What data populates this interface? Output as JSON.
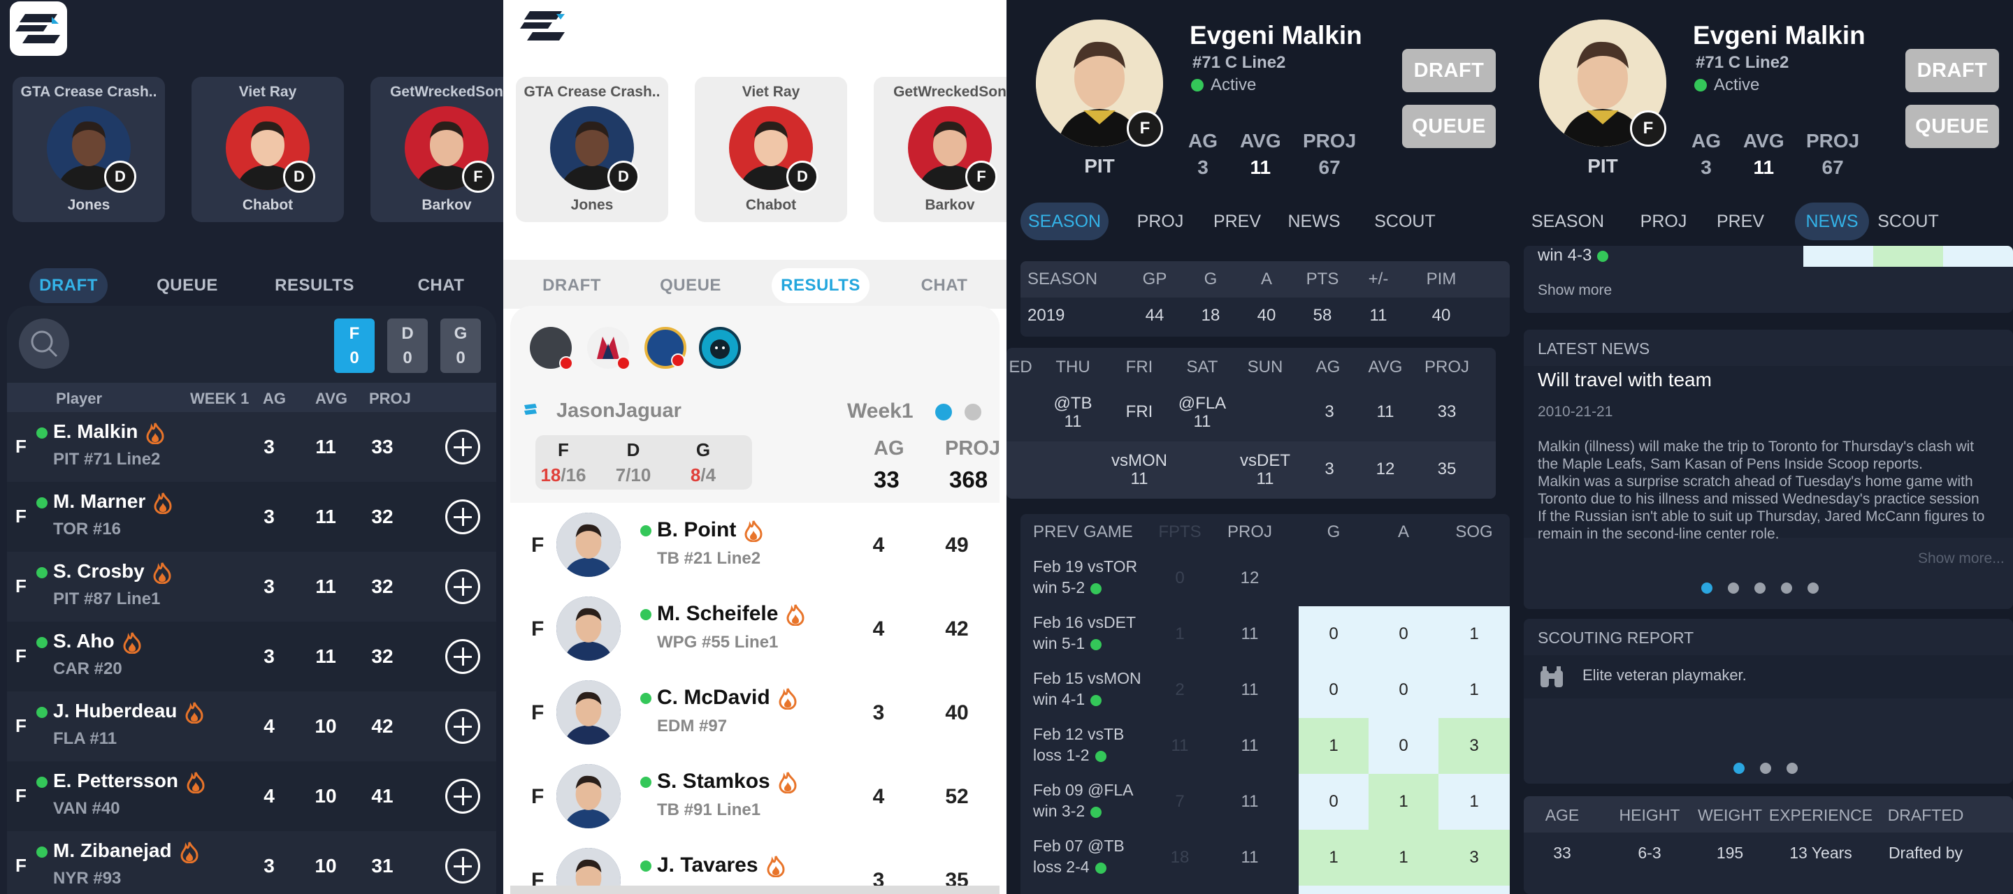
{
  "pick_cards": [
    {
      "team": "GTA Crease Crash..",
      "last_name": "Jones",
      "pos": "D",
      "skin": "#6b4533",
      "bg": "#1f3a66"
    },
    {
      "team": "Viet Ray",
      "last_name": "Chabot",
      "pos": "D",
      "skin": "#f0c6a8",
      "bg": "#d22b2b"
    },
    {
      "team": "GetWreckedSon",
      "last_name": "Barkov",
      "pos": "F",
      "skin": "#e8b99a",
      "bg": "#c8202e"
    }
  ],
  "tabs": [
    "DRAFT",
    "QUEUE",
    "RESULTS",
    "CHAT"
  ],
  "draft_panel": {
    "pos_filters": [
      {
        "label": "F",
        "count": "0",
        "color": "#1ea7e4"
      },
      {
        "label": "D",
        "count": "0",
        "color": "#4a5160"
      },
      {
        "label": "G",
        "count": "0",
        "color": "#4a5160"
      }
    ],
    "headers": [
      "Player",
      "WEEK 1",
      "AG",
      "AVG",
      "PROJ"
    ],
    "rows": [
      {
        "pos": "F",
        "name": "E. Malkin",
        "sub": "PIT #71 Line2",
        "ag": "3",
        "avg": "11",
        "proj": "33"
      },
      {
        "pos": "F",
        "name": "M. Marner",
        "sub": "TOR #16",
        "ag": "3",
        "avg": "11",
        "proj": "32"
      },
      {
        "pos": "F",
        "name": "S. Crosby",
        "sub": "PIT #87 Line1",
        "ag": "3",
        "avg": "11",
        "proj": "32"
      },
      {
        "pos": "F",
        "name": "S. Aho",
        "sub": "CAR #20",
        "ag": "3",
        "avg": "11",
        "proj": "32"
      },
      {
        "pos": "F",
        "name": "J. Huberdeau",
        "sub": "FLA #11",
        "ag": "4",
        "avg": "10",
        "proj": "42"
      },
      {
        "pos": "F",
        "name": "E. Pettersson",
        "sub": "VAN #40",
        "ag": "4",
        "avg": "10",
        "proj": "41"
      },
      {
        "pos": "F",
        "name": "M. Zibanejad",
        "sub": "NYR #93",
        "ag": "3",
        "avg": "10",
        "proj": "31"
      }
    ]
  },
  "results_panel": {
    "team_name": "JasonJaguar",
    "week": "Week1",
    "summary": {
      "F": "18",
      "F_total": "/16",
      "D": "7/10",
      "G": "8",
      "G_total": "/4"
    },
    "ag_label": "AG",
    "ag": "33",
    "proj_label": "PROJ",
    "proj": "368",
    "rows": [
      {
        "pos": "F",
        "name": "B. Point",
        "sub": "TB #21 Line2",
        "ag": "4",
        "proj": "49",
        "jersey": "#1d3f75"
      },
      {
        "pos": "F",
        "name": "M. Scheifele",
        "sub": "WPG #55 Line1",
        "ag": "4",
        "proj": "42",
        "jersey": "#1b3463"
      },
      {
        "pos": "F",
        "name": "C. McDavid",
        "sub": "EDM #97",
        "ag": "3",
        "proj": "40",
        "jersey": "#1c2f5a"
      },
      {
        "pos": "F",
        "name": "S. Stamkos",
        "sub": "TB #91 Line1",
        "ag": "4",
        "proj": "52",
        "jersey": "#1d3f75"
      },
      {
        "pos": "F",
        "name": "J. Tavares",
        "sub": "",
        "ag": "3",
        "proj": "35",
        "jersey": "#1d3f75"
      }
    ]
  },
  "player": {
    "name": "Evgeni Malkin",
    "info": "#71 C Line2",
    "status": "Active",
    "team": "PIT",
    "badge": "F",
    "stats": [
      {
        "k": "AG",
        "v": "3"
      },
      {
        "k": "AVG",
        "v": "11"
      },
      {
        "k": "PROJ",
        "v": "67"
      }
    ],
    "draft_label": "DRAFT",
    "queue_label": "QUEUE"
  },
  "detail_tabs": [
    "SEASON",
    "PROJ",
    "PREV",
    "NEWS",
    "SCOUT"
  ],
  "season_table": {
    "headers": [
      "SEASON",
      "GP",
      "G",
      "A",
      "PTS",
      "+/-",
      "PIM"
    ],
    "row": [
      "2019",
      "44",
      "18",
      "40",
      "58",
      "11",
      "40"
    ]
  },
  "schedule_table": {
    "headers": [
      "ED",
      "THU",
      "FRI",
      "SAT",
      "SUN",
      "AG",
      "AVG",
      "PROJ"
    ],
    "rows": [
      {
        "thu": "@TB",
        "thu2": "11",
        "fri": "FRI",
        "sat": "@FLA",
        "sat2": "11",
        "ag": "3",
        "avg": "11",
        "proj": "33"
      },
      {
        "fri": "vsMON",
        "fri2": "11",
        "sun": "vsDET",
        "sun2": "11",
        "ag": "3",
        "avg": "12",
        "proj": "35"
      }
    ]
  },
  "prev_table": {
    "headers": [
      "PREV GAME",
      "FPTS",
      "PROJ",
      "G",
      "A",
      "SOG"
    ],
    "rows": [
      {
        "date": "Feb 19 vsTOR",
        "res": "win 5-2",
        "fpts": "0",
        "proj": "12",
        "g": "",
        "a": "",
        "sog": ""
      },
      {
        "date": "Feb 16 vsDET",
        "res": "win 5-1",
        "fpts": "1",
        "proj": "11",
        "g": "0",
        "a": "0",
        "sog": "1"
      },
      {
        "date": "Feb 15 vsMON",
        "res": "win 4-1",
        "fpts": "2",
        "proj": "11",
        "g": "0",
        "a": "0",
        "sog": "1"
      },
      {
        "date": "Feb 12 vsTB",
        "res": "loss 1-2",
        "fpts": "11",
        "proj": "11",
        "g": "1",
        "a": "0",
        "sog": "3"
      },
      {
        "date": "Feb 09 @FLA",
        "res": "win 3-2",
        "fpts": "7",
        "proj": "11",
        "g": "0",
        "a": "1",
        "sog": "1"
      },
      {
        "date": "Feb 07 @TB",
        "res": "loss 2-4",
        "fpts": "18",
        "proj": "11",
        "g": "1",
        "a": "1",
        "sog": "3"
      }
    ]
  },
  "news": {
    "top_fragment": "win 4-3",
    "show_more": "Show more",
    "section": "LATEST NEWS",
    "headline": "Will travel with team",
    "date": "2010-21-21",
    "body": "Malkin (illness) will make the trip to Toronto for Thursday's clash wit\nthe Maple Leafs, Sam Kasan of Pens Inside Scoop reports.\nMalkin was a surprise scratch ahead of Tuesday's home game with\nToronto due to his illness and missed Wednesday's practice session\nIf the Russian isn't able to suit up Thursday, Jared McCann figures to\nremain in the second-line center role.",
    "show_more2": "Show more..."
  },
  "scouting": {
    "section": "SCOUTING REPORT",
    "text": "Elite veteran playmaker."
  },
  "bio": {
    "headers": [
      "AGE",
      "HEIGHT",
      "WEIGHT",
      "EXPERIENCE",
      "DRAFTED"
    ],
    "values": [
      "33",
      "6-3",
      "195",
      "13 Years",
      "Drafted by"
    ]
  },
  "colors": {
    "accent": "#22a6dd",
    "green": "#34c759",
    "fire": "#e8742a",
    "red": "#e0403a"
  }
}
